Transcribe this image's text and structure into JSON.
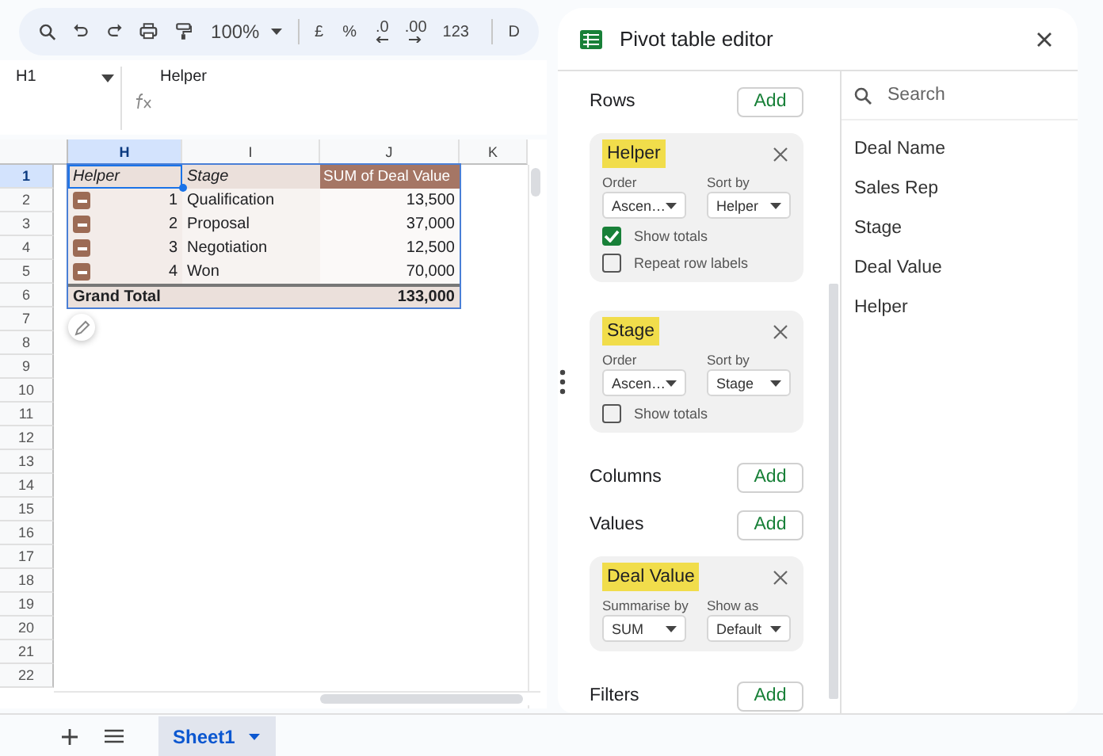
{
  "toolbar": [
    {
      "kind": "search"
    },
    {
      "kind": "undo"
    },
    {
      "kind": "redo"
    },
    {
      "kind": "print"
    },
    {
      "kind": "paint"
    },
    {
      "kind": "zoom",
      "label": "100%"
    },
    {
      "kind": "sep"
    },
    {
      "kind": "text",
      "label": "£"
    },
    {
      "kind": "text",
      "label": "%"
    },
    {
      "kind": "decrease_decimal",
      "label": ".0"
    },
    {
      "kind": "increase_decimal",
      "label": ".00"
    },
    {
      "kind": "text",
      "label": "123"
    },
    {
      "kind": "sep"
    },
    {
      "kind": "text",
      "label": "D"
    }
  ],
  "name_box": "H1",
  "formula": "Helper",
  "columns": [
    {
      "label": "H",
      "selected": true
    },
    {
      "label": "I",
      "selected": false
    },
    {
      "label": "J",
      "selected": false
    },
    {
      "label": "K",
      "selected": false
    }
  ],
  "rows": [
    {
      "label": "1",
      "selected": true
    },
    {
      "label": "2",
      "selected": false
    },
    {
      "label": "3",
      "selected": false
    },
    {
      "label": "4",
      "selected": false
    },
    {
      "label": "5",
      "selected": false
    },
    {
      "label": "6",
      "selected": false
    },
    {
      "label": "7",
      "selected": false
    },
    {
      "label": "8",
      "selected": false
    },
    {
      "label": "9",
      "selected": false
    },
    {
      "label": "10",
      "selected": false
    },
    {
      "label": "11",
      "selected": false
    },
    {
      "label": "12",
      "selected": false
    },
    {
      "label": "13",
      "selected": false
    },
    {
      "label": "14",
      "selected": false
    },
    {
      "label": "15",
      "selected": false
    },
    {
      "label": "16",
      "selected": false
    },
    {
      "label": "17",
      "selected": false
    },
    {
      "label": "18",
      "selected": false
    },
    {
      "label": "19",
      "selected": false
    },
    {
      "label": "20",
      "selected": false
    },
    {
      "label": "21",
      "selected": false
    },
    {
      "label": "22",
      "selected": false
    }
  ],
  "pivot": {
    "headers": [
      "Helper",
      "Stage",
      "SUM of Deal Value"
    ],
    "rows": [
      {
        "helper": "1",
        "stage": "Qualification",
        "value": "13,500",
        "expanded": true
      },
      {
        "helper": "2",
        "stage": "Proposal",
        "value": "37,000",
        "expanded": true
      },
      {
        "helper": "3",
        "stage": "Negotiation",
        "value": "12,500",
        "expanded": true
      },
      {
        "helper": "4",
        "stage": "Won",
        "value": "70,000",
        "expanded": true
      }
    ],
    "total": {
      "label": "Grand Total",
      "value": "133,000"
    }
  },
  "editor": {
    "title": "Pivot table editor",
    "sections": [
      {
        "label": "Rows",
        "button": "Add",
        "cards": [
          {
            "field": "Helper",
            "dropdowns": [
              {
                "label": "Order",
                "value": "Ascen…"
              },
              {
                "label": "Sort by",
                "value": "Helper"
              }
            ],
            "checkboxes": [
              {
                "label": "Show totals",
                "checked": true
              },
              {
                "label": "Repeat row labels",
                "checked": false
              }
            ]
          },
          {
            "field": "Stage",
            "dropdowns": [
              {
                "label": "Order",
                "value": "Ascen…"
              },
              {
                "label": "Sort by",
                "value": "Stage"
              }
            ],
            "checkboxes": [
              {
                "label": "Show totals",
                "checked": false
              }
            ]
          }
        ]
      },
      {
        "label": "Columns",
        "button": "Add"
      },
      {
        "label": "Values",
        "button": "Add",
        "cards": [
          {
            "field": "Deal Value",
            "dropdowns": [
              {
                "label": "Summarise by",
                "value": "SUM"
              },
              {
                "label": "Show as",
                "value": "Default"
              }
            ]
          }
        ]
      },
      {
        "label": "Filters",
        "button": "Add"
      }
    ],
    "fields": {
      "placeholder": "Search",
      "items": [
        "Deal Name",
        "Sales Rep",
        "Stage",
        "Deal Value",
        "Helper"
      ]
    }
  },
  "sheet_tabs": [
    {
      "label": "Sheet1",
      "selected": true
    }
  ]
}
